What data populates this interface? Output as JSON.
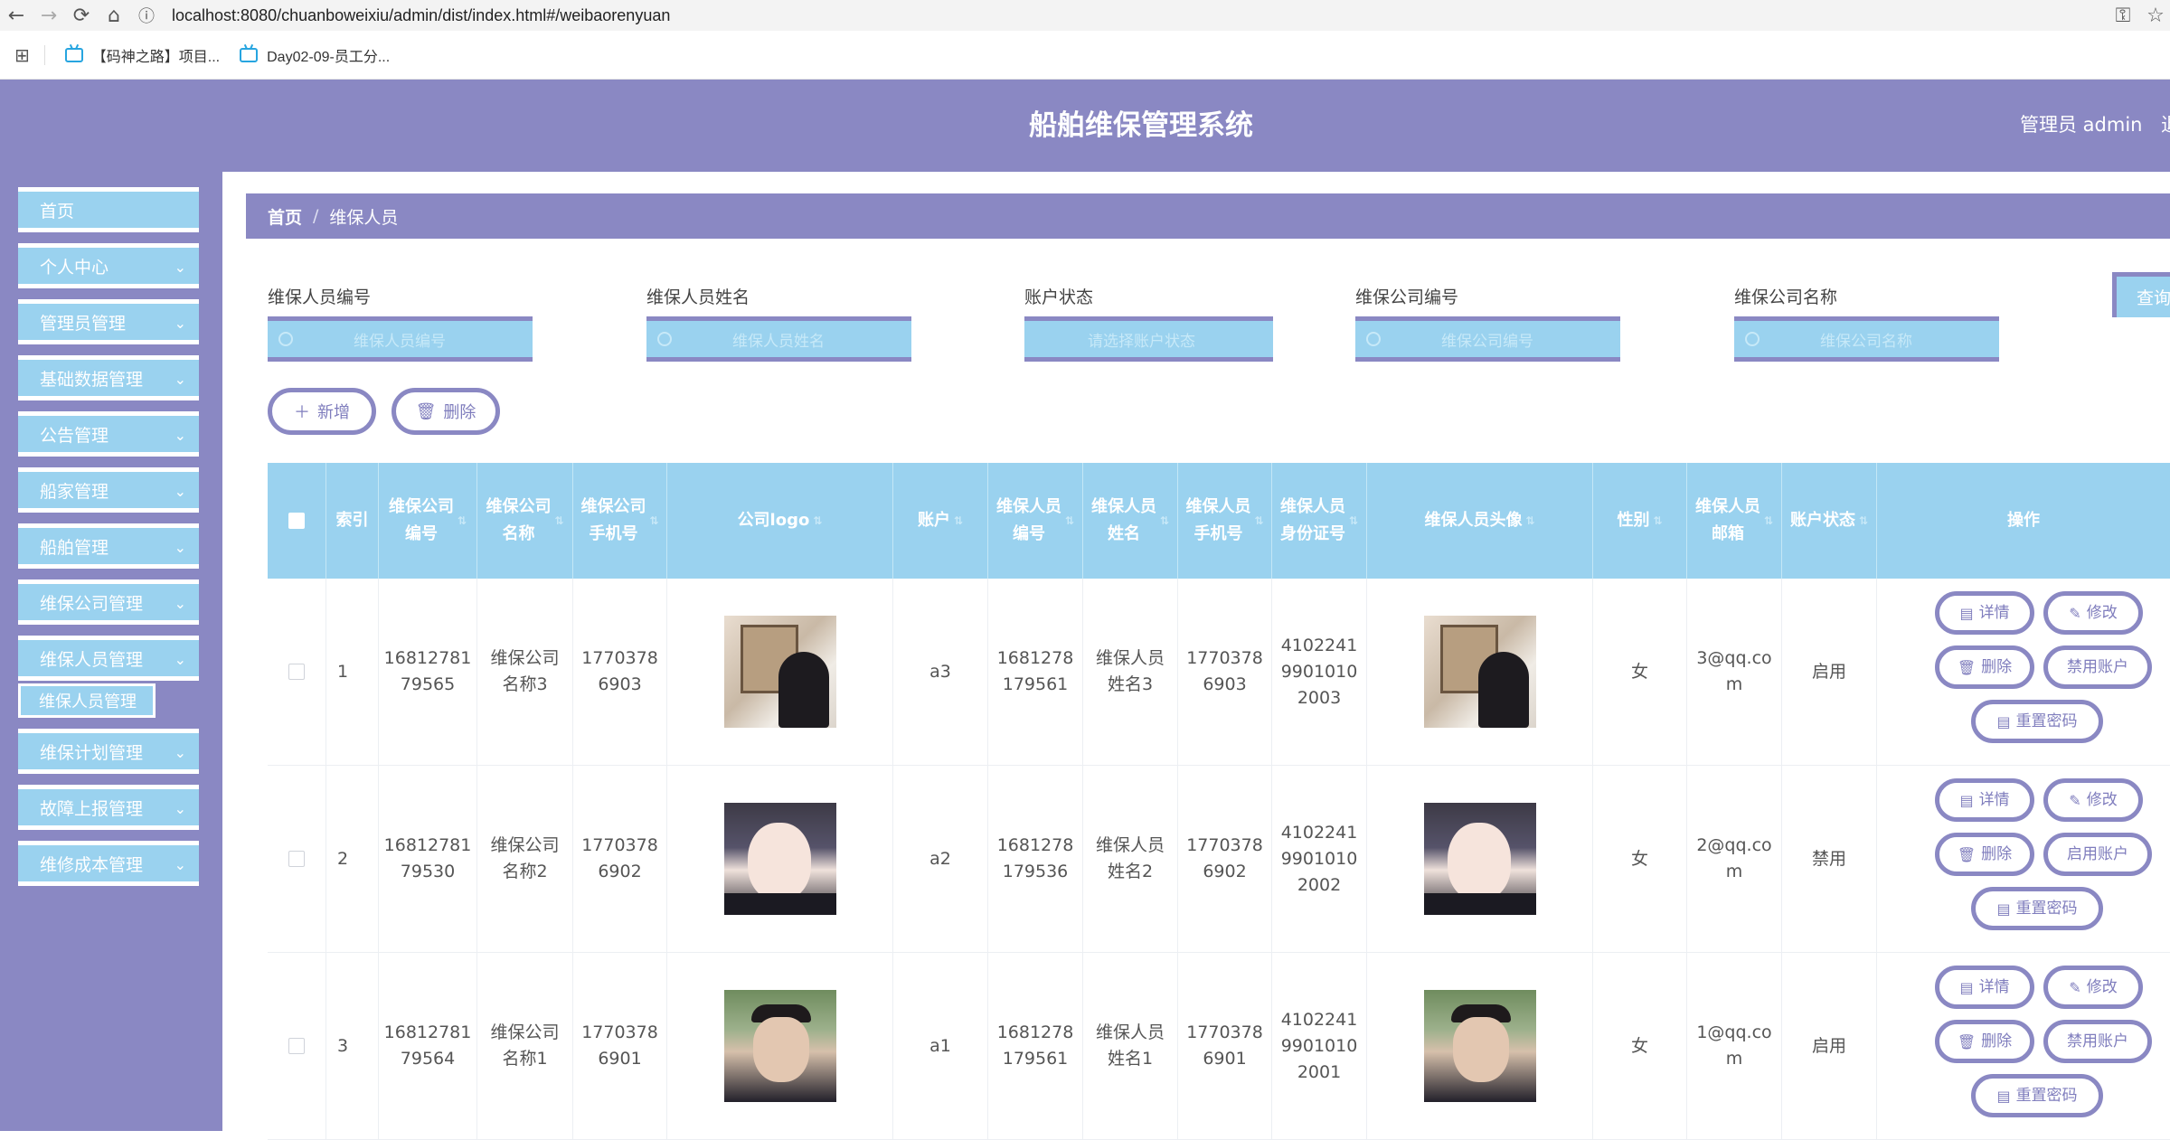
{
  "browser": {
    "url": "localhost:8080/chuanboweixiu/admin/dist/index.html#/weibaorenyuan",
    "bookmarks": [
      "【码神之路】项目...",
      "Day02-09-员工分..."
    ]
  },
  "header": {
    "title": "船舶维保管理系统",
    "admin_text": "管理员 admin",
    "logout_text": "退"
  },
  "sidebar": {
    "items": [
      {
        "label": "首页",
        "expandable": false
      },
      {
        "label": "个人中心",
        "expandable": true
      },
      {
        "label": "管理员管理",
        "expandable": true
      },
      {
        "label": "基础数据管理",
        "expandable": true
      },
      {
        "label": "公告管理",
        "expandable": true
      },
      {
        "label": "船家管理",
        "expandable": true
      },
      {
        "label": "船舶管理",
        "expandable": true
      },
      {
        "label": "维保公司管理",
        "expandable": true
      },
      {
        "label": "维保人员管理",
        "expandable": true
      },
      {
        "label": "维保计划管理",
        "expandable": true
      },
      {
        "label": "故障上报管理",
        "expandable": true
      },
      {
        "label": "维修成本管理",
        "expandable": true
      }
    ],
    "active_sub": "维保人员管理"
  },
  "breadcrumb": {
    "home": "首页",
    "separator": "/",
    "current": "维保人员"
  },
  "filters": [
    {
      "label": "维保人员编号",
      "placeholder": "维保人员编号"
    },
    {
      "label": "维保人员姓名",
      "placeholder": "维保人员姓名"
    },
    {
      "label": "账户状态",
      "placeholder": "请选择账户状态"
    },
    {
      "label": "维保公司编号",
      "placeholder": "维保公司编号"
    },
    {
      "label": "维保公司名称",
      "placeholder": "维保公司名称"
    }
  ],
  "query_button": "查询",
  "toolbar": {
    "add_label": "新增",
    "delete_label": "删除"
  },
  "table": {
    "columns": [
      "",
      "索引",
      "维保公司\n编号",
      "维保公司\n名称",
      "维保公司\n手机号",
      "公司logo",
      "账户",
      "维保人员\n编号",
      "维保人员\n姓名",
      "维保人员\n手机号",
      "维保人员\n身份证号",
      "维保人员头像",
      "性别",
      "维保人员\n邮箱",
      "账户状态",
      "操作"
    ],
    "rows": [
      {
        "index": "1",
        "company_no": "16812781\n79565",
        "company_name": "维保公司\n名称3",
        "company_phone": "1770378\n6903",
        "logo": "portrait-cat",
        "account": "a3",
        "staff_no": "1681278\n179561",
        "staff_name": "维保人员\n姓名3",
        "staff_phone": "1770378\n6903",
        "id_card": "4102241\n9901010\n2003",
        "avatar": "portrait-cat",
        "gender": "女",
        "email": "3@qq.co\nm",
        "status": "启用",
        "account_action": "禁用账户"
      },
      {
        "index": "2",
        "company_no": "16812781\n79530",
        "company_name": "维保公司\n名称2",
        "company_phone": "1770378\n6902",
        "logo": "portrait-girl",
        "account": "a2",
        "staff_no": "1681278\n179536",
        "staff_name": "维保人员\n姓名2",
        "staff_phone": "1770378\n6902",
        "id_card": "4102241\n9901010\n2002",
        "avatar": "portrait-girl",
        "gender": "女",
        "email": "2@qq.co\nm",
        "status": "禁用",
        "account_action": "启用账户"
      },
      {
        "index": "3",
        "company_no": "16812781\n79564",
        "company_name": "维保公司\n名称1",
        "company_phone": "1770378\n6901",
        "logo": "portrait-boy",
        "account": "a1",
        "staff_no": "1681278\n179561",
        "staff_name": "维保人员\n姓名1",
        "staff_phone": "1770378\n6901",
        "id_card": "4102241\n9901010\n2001",
        "avatar": "portrait-boy",
        "gender": "女",
        "email": "1@qq.co\nm",
        "status": "启用",
        "account_action": "禁用账户"
      }
    ],
    "action_labels": {
      "detail": "详情",
      "edit": "修改",
      "delete": "删除",
      "reset_password": "重置密码"
    }
  },
  "colors": {
    "primary": "#8a88c3",
    "accent": "#9ad2ef",
    "text": "#555555"
  }
}
